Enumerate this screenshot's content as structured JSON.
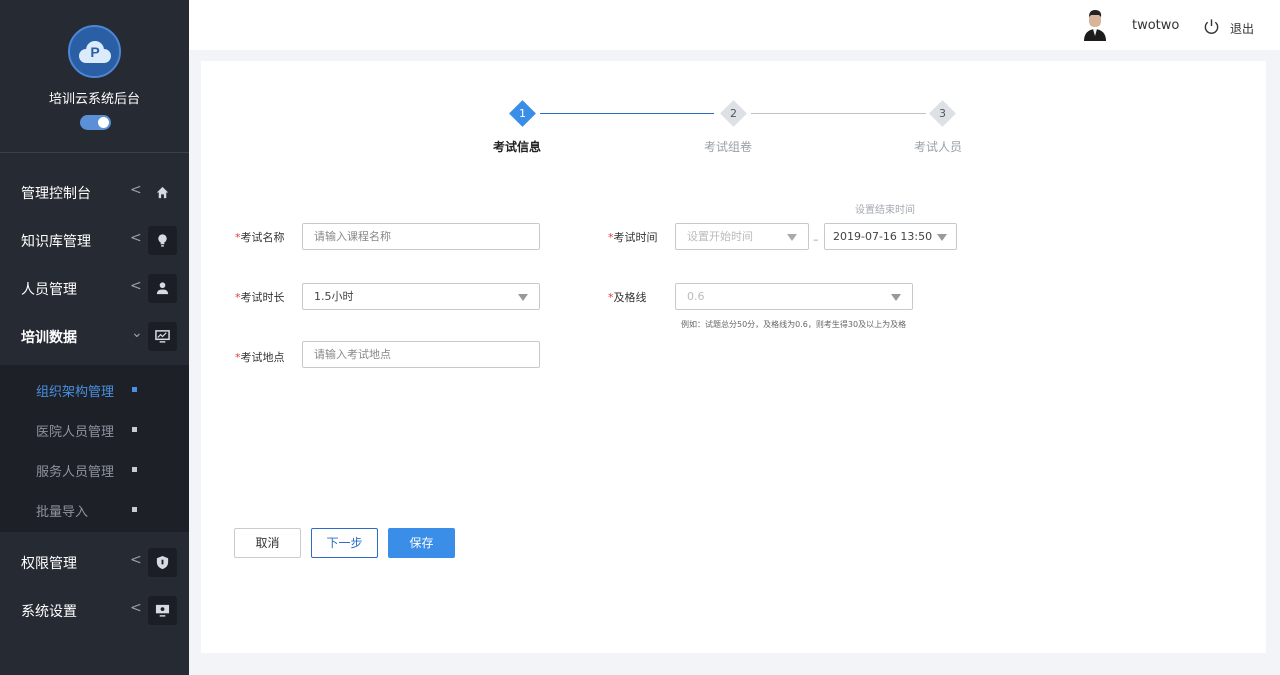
{
  "sidebar": {
    "brand_title": "培训云系统后台",
    "logo_letter": "P",
    "menu": [
      {
        "label": "管理控制台",
        "icon": "home-icon"
      },
      {
        "label": "知识库管理",
        "icon": "lightbulb-icon"
      },
      {
        "label": "人员管理",
        "icon": "users-icon"
      },
      {
        "label": "培训数据",
        "icon": "monitor-icon",
        "expanded": true
      },
      {
        "label": "权限管理",
        "icon": "shield-icon"
      },
      {
        "label": "系统设置",
        "icon": "screen-icon"
      }
    ],
    "submenu": [
      {
        "label": "组织架构管理",
        "active": true
      },
      {
        "label": "医院人员管理"
      },
      {
        "label": "服务人员管理"
      },
      {
        "label": "批量导入"
      }
    ]
  },
  "header": {
    "username": "twotwo",
    "logout": "退出"
  },
  "steps": [
    {
      "num": "1",
      "label": "考试信息",
      "state": "active"
    },
    {
      "num": "2",
      "label": "考试组卷",
      "state": "pending"
    },
    {
      "num": "3",
      "label": "考试人员",
      "state": "pending"
    }
  ],
  "form": {
    "required_mark": "*",
    "name_label": "考试名称",
    "name_placeholder": "请输入课程名称",
    "time_label": "考试时间",
    "start_placeholder": "设置开始时间",
    "separator": "–",
    "end_hint": "设置结束时间",
    "end_value": "2019-07-16  13:50",
    "duration_label": "考试时长",
    "duration_value": "1.5小时",
    "pass_label": "及格线",
    "pass_value": "0.6",
    "pass_hint": "例如：试题总分50分，及格线为0.6，则考生得30及以上为及格",
    "location_label": "考试地点",
    "location_placeholder": "请输入考试地点"
  },
  "buttons": {
    "cancel": "取消",
    "next": "下一步",
    "save": "保存"
  },
  "colors": {
    "sidebar_bg": "#262a33",
    "accent": "#3b8ee8",
    "required": "#e23b3b"
  }
}
